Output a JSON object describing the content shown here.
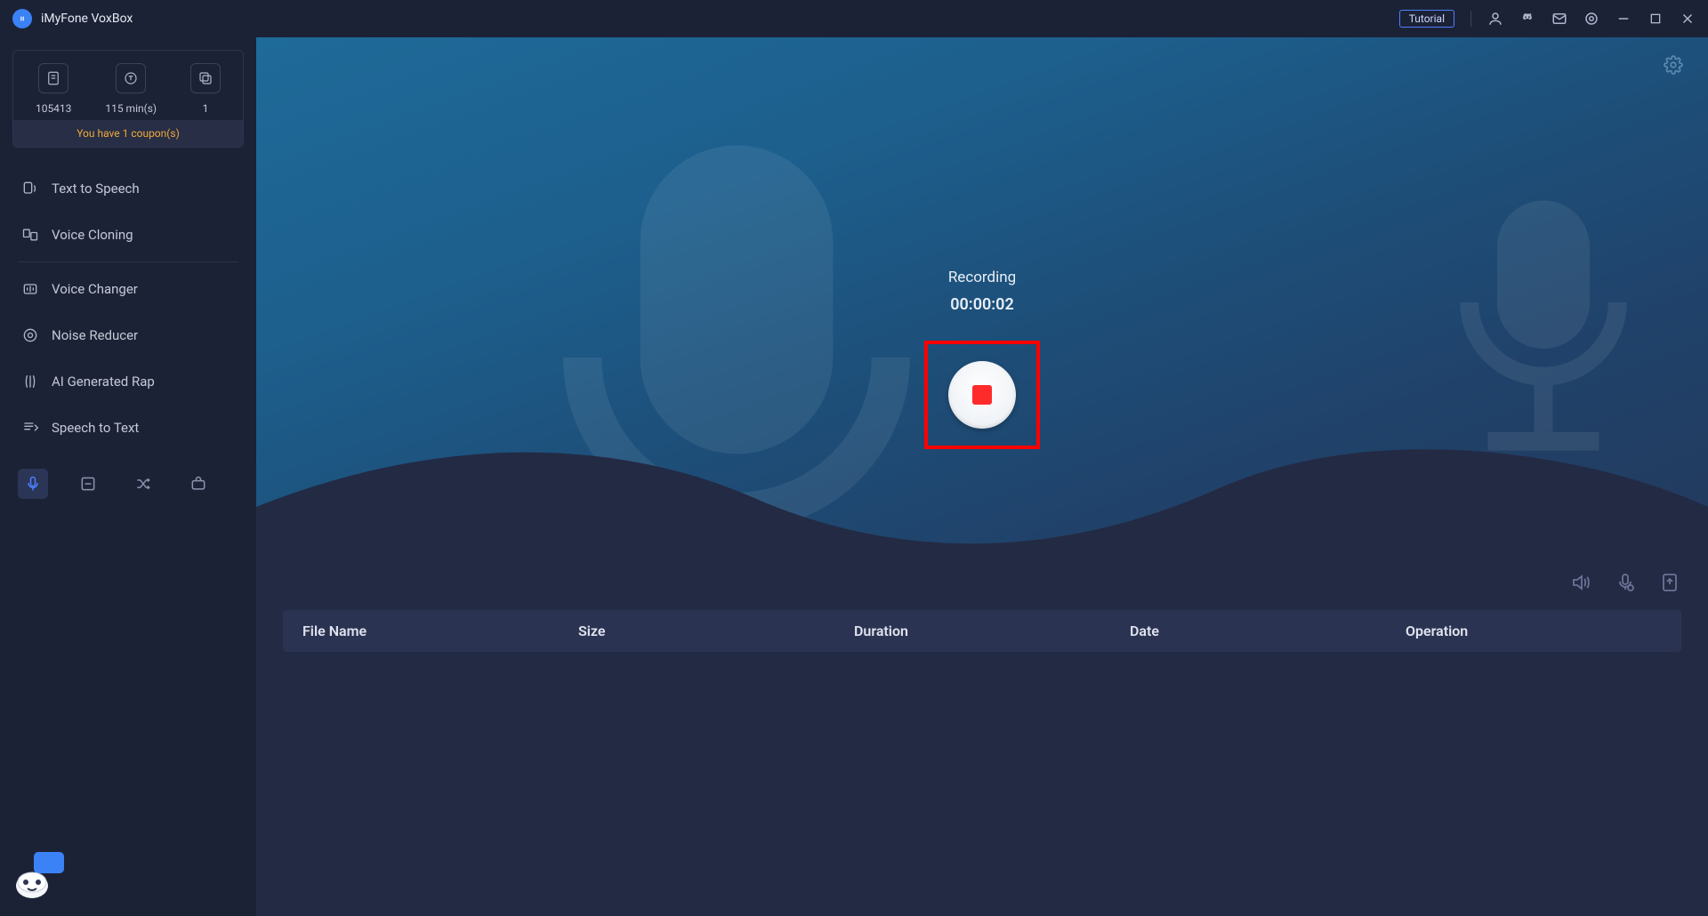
{
  "app": {
    "title": "iMyFone VoxBox"
  },
  "titlebar": {
    "tutorial": "Tutorial"
  },
  "stats": {
    "value1": "105413",
    "value2": "115 min(s)",
    "value3": "1",
    "coupon": "You have 1 coupon(s)"
  },
  "nav": {
    "text_to_speech": "Text to Speech",
    "voice_cloning": "Voice Cloning",
    "voice_changer": "Voice Changer",
    "noise_reducer": "Noise Reducer",
    "ai_rap": "AI Generated Rap",
    "speech_to_text": "Speech to Text"
  },
  "recording": {
    "label": "Recording",
    "time": "00:00:02"
  },
  "table": {
    "filename": "File Name",
    "size": "Size",
    "duration": "Duration",
    "date": "Date",
    "operation": "Operation"
  }
}
